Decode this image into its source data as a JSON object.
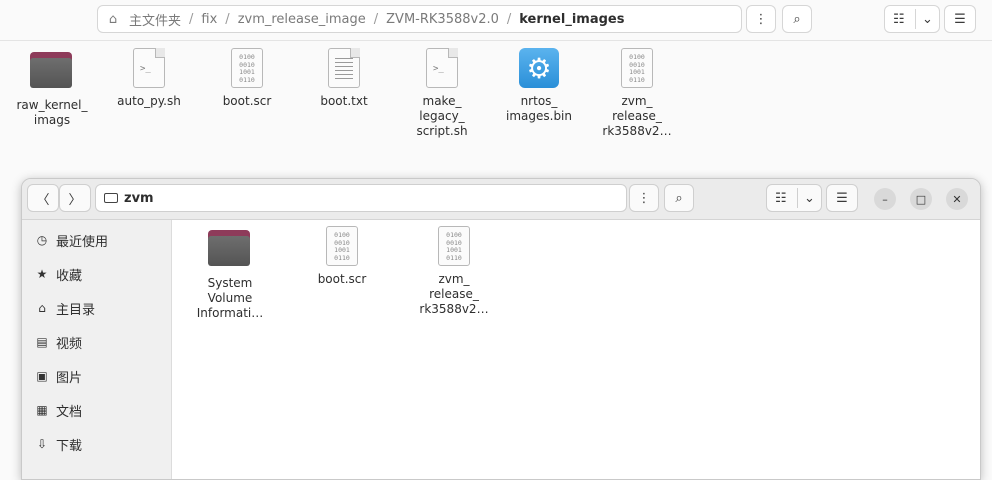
{
  "bg_window": {
    "path": [
      "主文件夹",
      "fix",
      "zvm_release_image",
      "ZVM-RK3588v2.0",
      "kernel_images"
    ],
    "menu_icon": "⋮",
    "search_icon": "⌕",
    "view_icon": "☷",
    "dropdown_icon": "⌄",
    "hamburger_icon": "☰",
    "files": [
      {
        "name": "raw_kernel_\nimags",
        "icon": "folder"
      },
      {
        "name": "auto_py.sh",
        "icon": "script"
      },
      {
        "name": "boot.scr",
        "icon": "binary"
      },
      {
        "name": "boot.txt",
        "icon": "text"
      },
      {
        "name": "make_\nlegacy_\nscript.sh",
        "icon": "script"
      },
      {
        "name": "nrtos_\nimages.bin",
        "icon": "gear"
      },
      {
        "name": "zvm_\nrelease_\nrk3588v2…",
        "icon": "binary"
      }
    ]
  },
  "fg_window": {
    "location": "zvm",
    "back_icon": "〈",
    "forward_icon": "〉",
    "menu_icon": "⋮",
    "search_icon": "⌕",
    "view_icon": "☷",
    "dropdown_icon": "⌄",
    "hamburger_icon": "☰",
    "minimize_icon": "–",
    "maximize_icon": "□",
    "close_icon": "✕",
    "sidebar": [
      {
        "label": "最近使用",
        "icon": "🕓"
      },
      {
        "label": "收藏",
        "icon": "★"
      },
      {
        "label": "主目录",
        "icon": "⌂"
      },
      {
        "label": "视频",
        "icon": "▤"
      },
      {
        "label": "图片",
        "icon": "▣"
      },
      {
        "label": "文档",
        "icon": "▦"
      },
      {
        "label": "下载",
        "icon": "⇩"
      }
    ],
    "files": [
      {
        "name": "System\nVolume\nInformati…",
        "icon": "folder"
      },
      {
        "name": "boot.scr",
        "icon": "binary"
      },
      {
        "name": "zvm_\nrelease_\nrk3588v2…",
        "icon": "binary"
      }
    ]
  },
  "binary_glyph": "0100\n0010\n1001\n0110",
  "script_glyph": ">_"
}
